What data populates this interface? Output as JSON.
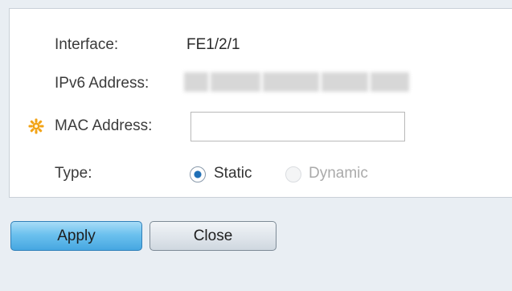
{
  "form": {
    "interface_label": "Interface:",
    "interface_value": "FE1/2/1",
    "ipv6_label": "IPv6 Address:",
    "mac_label": "MAC Address:",
    "mac_value": "",
    "type_label": "Type:",
    "type_options": [
      {
        "label": "Static",
        "selected": true,
        "enabled": true
      },
      {
        "label": "Dynamic",
        "selected": false,
        "enabled": false
      }
    ]
  },
  "buttons": {
    "apply_label": "Apply",
    "close_label": "Close"
  },
  "icons": {
    "required": "required-asterisk-icon"
  },
  "colors": {
    "required_icon": "#f2a316",
    "apply_button": "#5bb8ea",
    "disabled_text": "#aaaaaa"
  }
}
